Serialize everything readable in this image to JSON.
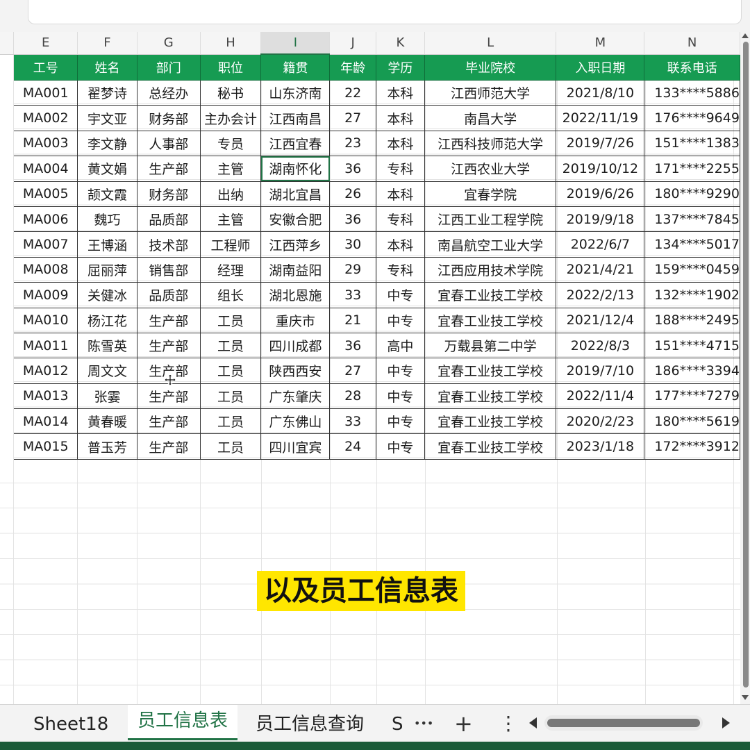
{
  "columns": [
    "E",
    "F",
    "G",
    "H",
    "I",
    "J",
    "K",
    "L",
    "M",
    "N"
  ],
  "selected_column": "I",
  "headers": [
    "工号",
    "姓名",
    "部门",
    "职位",
    "籍贯",
    "年龄",
    "学历",
    "毕业院校",
    "入职日期",
    "联系电话"
  ],
  "rows": [
    [
      "MA001",
      "翟梦诗",
      "总经办",
      "秘书",
      "山东济南",
      "22",
      "本科",
      "江西师范大学",
      "2021/8/10",
      "133****5886"
    ],
    [
      "MA002",
      "宇文亚",
      "财务部",
      "主办会计",
      "江西南昌",
      "27",
      "本科",
      "南昌大学",
      "2022/11/19",
      "176****9649"
    ],
    [
      "MA003",
      "李文静",
      "人事部",
      "专员",
      "江西宜春",
      "23",
      "本科",
      "江西科技师范大学",
      "2019/7/26",
      "151****1383"
    ],
    [
      "MA004",
      "黄文娟",
      "生产部",
      "主管",
      "湖南怀化",
      "36",
      "专科",
      "江西农业大学",
      "2019/10/12",
      "171****2255"
    ],
    [
      "MA005",
      "颉文霞",
      "财务部",
      "出纳",
      "湖北宜昌",
      "26",
      "本科",
      "宜春学院",
      "2019/6/26",
      "180****9290"
    ],
    [
      "MA006",
      "魏巧",
      "品质部",
      "主管",
      "安徽合肥",
      "36",
      "专科",
      "江西工业工程学院",
      "2019/9/18",
      "137****7845"
    ],
    [
      "MA007",
      "王博涵",
      "技术部",
      "工程师",
      "江西萍乡",
      "30",
      "本科",
      "南昌航空工业大学",
      "2022/6/7",
      "134****5017"
    ],
    [
      "MA008",
      "屈丽萍",
      "销售部",
      "经理",
      "湖南益阳",
      "29",
      "专科",
      "江西应用技术学院",
      "2021/4/21",
      "159****0459"
    ],
    [
      "MA009",
      "关健冰",
      "品质部",
      "组长",
      "湖北恩施",
      "33",
      "中专",
      "宜春工业技工学校",
      "2022/2/13",
      "132****1902"
    ],
    [
      "MA010",
      "杨江花",
      "生产部",
      "工员",
      "重庆市",
      "21",
      "中专",
      "宜春工业技工学校",
      "2021/12/4",
      "188****2495"
    ],
    [
      "MA011",
      "陈雪英",
      "生产部",
      "工员",
      "四川成都",
      "36",
      "高中",
      "万载县第二中学",
      "2022/8/3",
      "151****4715"
    ],
    [
      "MA012",
      "周文文",
      "生产部",
      "工员",
      "陕西西安",
      "27",
      "中专",
      "宜春工业技工学校",
      "2019/7/10",
      "186****3394"
    ],
    [
      "MA013",
      "张霎",
      "生产部",
      "工员",
      "广东肇庆",
      "28",
      "中专",
      "宜春工业技工学校",
      "2022/11/4",
      "177****7279"
    ],
    [
      "MA014",
      "黄春暖",
      "生产部",
      "工员",
      "广东佛山",
      "33",
      "中专",
      "宜春工业技工学校",
      "2020/2/23",
      "180****5619"
    ],
    [
      "MA015",
      "普玉芳",
      "生产部",
      "工员",
      "四川宜宾",
      "24",
      "中专",
      "宜春工业技工学校",
      "2023/1/18",
      "172****3912"
    ]
  ],
  "caption": "以及员工信息表",
  "tabs": {
    "sheet18": "Sheet18",
    "active": "员工信息表",
    "query": "员工信息查询",
    "truncated": "S",
    "more": "•••",
    "add": "+",
    "menu": "⋮"
  },
  "colors": {
    "header_green": "#169b52",
    "accent": "#217346",
    "caption_bg": "#ffe600"
  }
}
